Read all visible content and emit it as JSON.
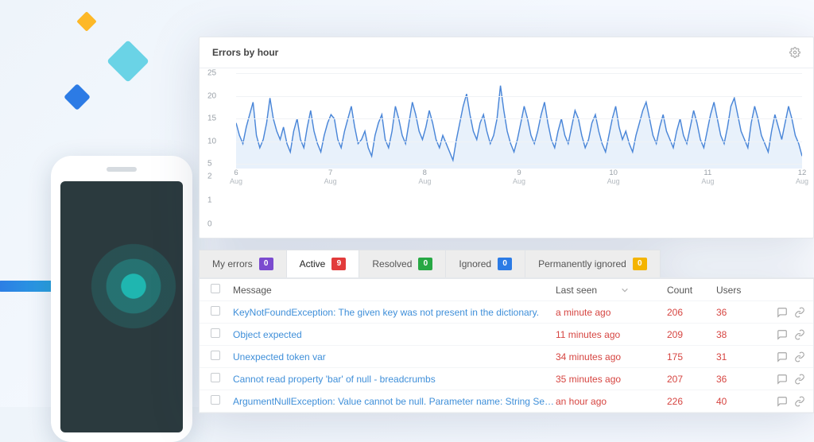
{
  "chart": {
    "title": "Errors by hour"
  },
  "chart_data": {
    "type": "line",
    "title": "Errors by hour",
    "xlabel": "",
    "ylabel": "",
    "ylim": [
      0,
      25
    ],
    "y_ticks": [
      25,
      20,
      15,
      10,
      5,
      2,
      1,
      0
    ],
    "x_ticks": [
      {
        "label": "6",
        "sub": "Aug"
      },
      {
        "label": "7",
        "sub": "Aug"
      },
      {
        "label": "8",
        "sub": "Aug"
      },
      {
        "label": "9",
        "sub": "Aug"
      },
      {
        "label": "10",
        "sub": "Aug"
      },
      {
        "label": "11",
        "sub": "Aug"
      },
      {
        "label": "12",
        "sub": "Aug"
      }
    ],
    "values": [
      13,
      10,
      8,
      12,
      15,
      18,
      10,
      7,
      9,
      13,
      19,
      14,
      11,
      9,
      12,
      8,
      6,
      11,
      14,
      9,
      7,
      12,
      16,
      11,
      8,
      6,
      10,
      13,
      15,
      14,
      9,
      7,
      11,
      14,
      17,
      12,
      8,
      9,
      11,
      7,
      5,
      10,
      13,
      15,
      9,
      7,
      11,
      17,
      14,
      10,
      8,
      13,
      18,
      15,
      11,
      9,
      12,
      16,
      13,
      9,
      7,
      10,
      8,
      6,
      4,
      9,
      13,
      17,
      20,
      15,
      11,
      9,
      13,
      15,
      11,
      8,
      10,
      14,
      22,
      16,
      11,
      8,
      6,
      9,
      13,
      17,
      14,
      10,
      8,
      11,
      15,
      18,
      13,
      9,
      7,
      11,
      14,
      10,
      8,
      12,
      16,
      14,
      10,
      7,
      9,
      13,
      15,
      11,
      8,
      6,
      10,
      14,
      17,
      12,
      9,
      11,
      8,
      6,
      10,
      13,
      16,
      18,
      14,
      10,
      8,
      12,
      15,
      11,
      9,
      7,
      11,
      14,
      10,
      8,
      12,
      16,
      13,
      9,
      7,
      11,
      15,
      18,
      14,
      10,
      8,
      12,
      17,
      19,
      15,
      11,
      9,
      7,
      13,
      17,
      14,
      10,
      8,
      6,
      11,
      15,
      12,
      9,
      13,
      17,
      14,
      10,
      8,
      5
    ]
  },
  "tabs": [
    {
      "label": "My errors",
      "count": "0",
      "color": "#7b4bcf"
    },
    {
      "label": "Active",
      "count": "9",
      "color": "#e23b3b",
      "active": true
    },
    {
      "label": "Resolved",
      "count": "0",
      "color": "#27a844"
    },
    {
      "label": "Ignored",
      "count": "0",
      "color": "#2c7be5"
    },
    {
      "label": "Permanently ignored",
      "count": "0",
      "color": "#f4b400"
    }
  ],
  "table": {
    "headers": {
      "message": "Message",
      "last_seen": "Last seen",
      "count": "Count",
      "users": "Users"
    },
    "rows": [
      {
        "message": "KeyNotFoundException: The given key was not present in the dictionary.",
        "last_seen": "a minute ago",
        "count": "206",
        "users": "36"
      },
      {
        "message": "Object expected",
        "last_seen": "11 minutes ago",
        "count": "209",
        "users": "38"
      },
      {
        "message": "Unexpected token var",
        "last_seen": "34 minutes ago",
        "count": "175",
        "users": "31"
      },
      {
        "message": "Cannot read property 'bar' of null - breadcrumbs",
        "last_seen": "35 minutes ago",
        "count": "207",
        "users": "36"
      },
      {
        "message": "ArgumentNullException: Value cannot be null. Parameter name: String Session + Github",
        "last_seen": "an hour ago",
        "count": "226",
        "users": "40"
      }
    ]
  }
}
